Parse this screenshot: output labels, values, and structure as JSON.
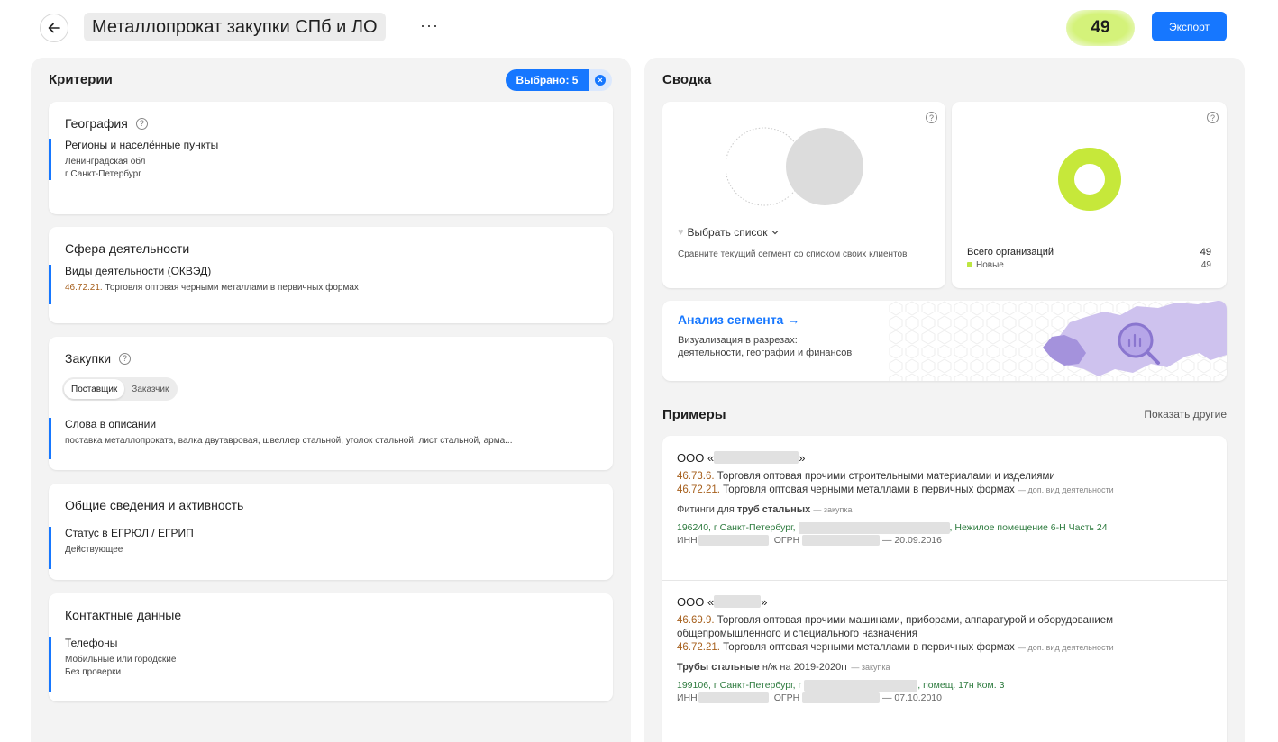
{
  "header": {
    "title": "Металлопрокат закупки СПб и ЛО",
    "more_label": "···",
    "count": "49",
    "export_label": "Экспорт"
  },
  "criteria": {
    "title": "Критерии",
    "selected_label": "Выбрано: 5",
    "clear_symbol": "×",
    "geography": {
      "title": "География",
      "label": "Регионы и населённые пункты",
      "values": [
        "Ленинградская обл",
        "г Санкт-Петербург"
      ]
    },
    "activity": {
      "title": "Сфера деятельности",
      "label": "Виды деятельности (ОКВЭД)",
      "code": "46.72.21.",
      "text": "Торговля оптовая черными металлами в первичных формах"
    },
    "procurement": {
      "title": "Закупки",
      "toggle": [
        "Поставщик",
        "Заказчик"
      ],
      "label": "Слова в описании",
      "text": "поставка металлопроката, валка двутавровая, швеллер стальной, уголок стальной, лист стальной, арма..."
    },
    "general": {
      "title": "Общие сведения и активность",
      "label": "Статус в ЕГРЮЛ / ЕГРИП",
      "value": "Действующее"
    },
    "contacts": {
      "title": "Контактные данные",
      "label": "Телефоны",
      "values": [
        "Мобильные или городские",
        "Без проверки"
      ]
    }
  },
  "summary": {
    "title": "Сводка",
    "help_symbol": "?",
    "select_list_label": "Выбрать список",
    "compare_text": "Сравните текущий сегмент со списком своих клиентов",
    "total_label": "Всего организаций",
    "total_value": "49",
    "new_label": "Новые",
    "new_value": "49",
    "donut_color": "#c6e83a",
    "analysis_title": "Анализ сегмента →",
    "analysis_lines": [
      "Визуализация в разрезах:",
      "деятельности, географии и финансов"
    ]
  },
  "examples": {
    "title": "Примеры",
    "show_more": "Показать другие",
    "items": [
      {
        "name_prefix": "ООО «",
        "name_suffix": "»",
        "lines": [
          {
            "code": "46.73.6.",
            "text": "Торговля оптовая прочими строительными материалами и изделиями",
            "note": ""
          },
          {
            "code": "46.72.21.",
            "text": "Торговля оптовая черными металлами в первичных формах",
            "note": "— доп. вид деятельности"
          }
        ],
        "procurement_pre": "Фитинги для ",
        "procurement_bold": "труб стальных",
        "procurement_post": "",
        "procurement_note": "— закупка",
        "address_start": "196240, г Санкт-Петербург,",
        "address_end": ", Нежилое помещение 6-Н Часть 24",
        "inn_label": "ИНН",
        "ogrn_label": "ОГРН",
        "date": "— 20.09.2016"
      },
      {
        "name_prefix": "ООО «",
        "name_suffix": "»",
        "lines": [
          {
            "code": "46.69.9.",
            "text": "Торговля оптовая прочими машинами, приборами, аппаратурой и оборудованием",
            "note": ""
          },
          {
            "code": "",
            "text": "общепромышленного и специального назначения",
            "note": ""
          },
          {
            "code": "46.72.21.",
            "text": "Торговля оптовая черными металлами в первичных формах",
            "note": "— доп. вид деятельности"
          }
        ],
        "procurement_pre": "",
        "procurement_bold": "Трубы стальные",
        "procurement_post": " н/ж на 2019-2020гг",
        "procurement_note": "— закупка",
        "address_start": "199106, г Санкт-Петербург, г",
        "address_end": ", помещ. 17н Ком. 3",
        "inn_label": "ИНН",
        "ogrn_label": "ОГРН",
        "date": "— 07.10.2010"
      }
    ]
  }
}
